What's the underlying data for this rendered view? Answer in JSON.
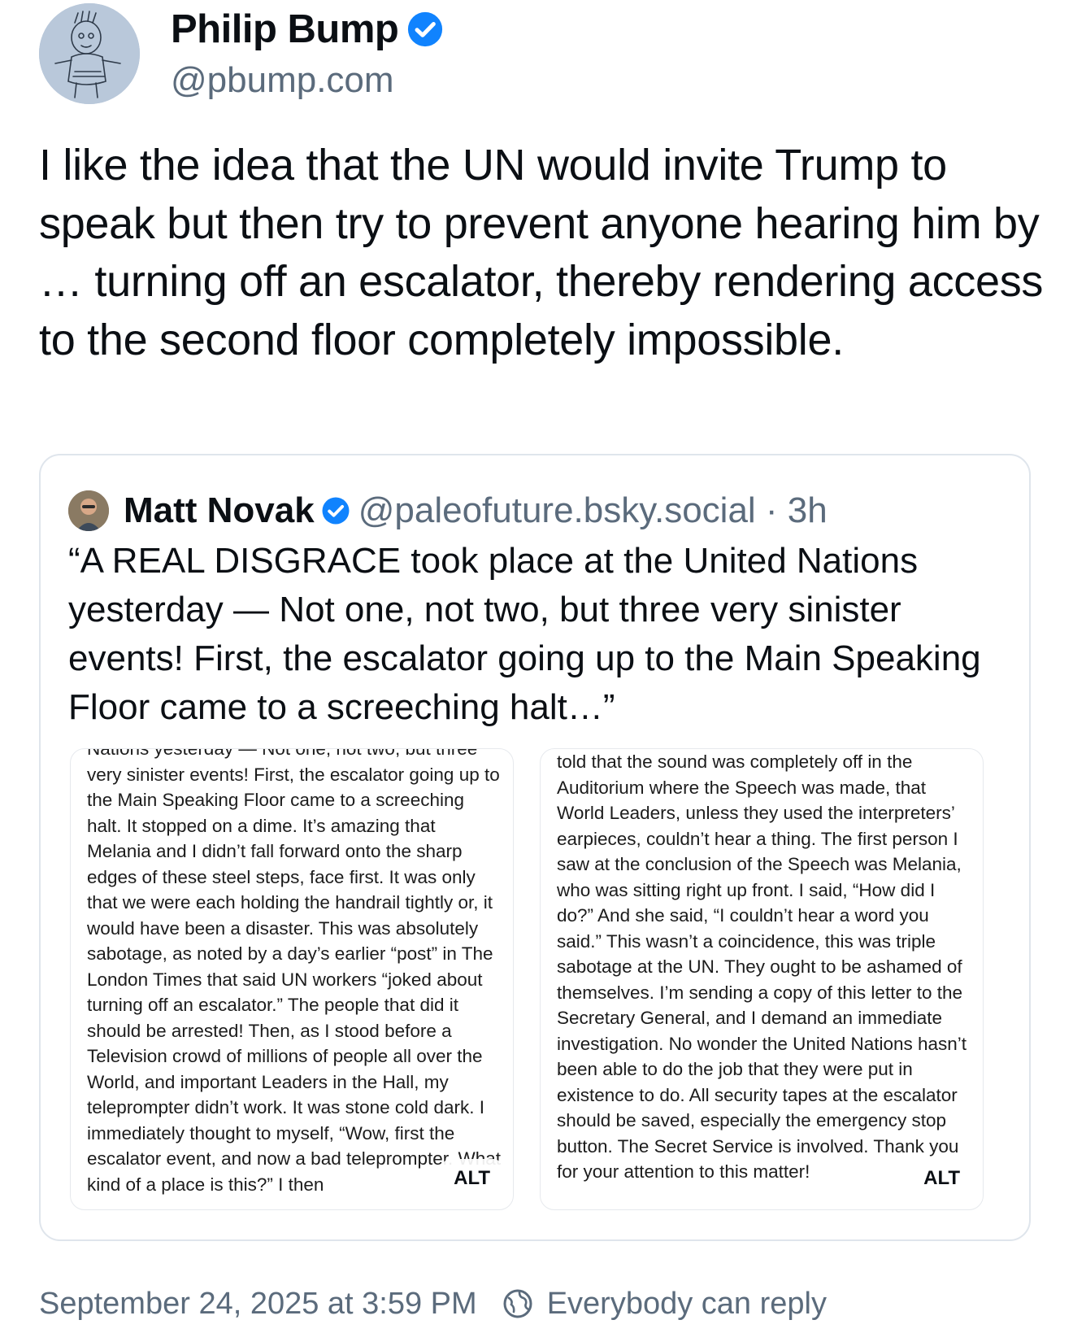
{
  "author": {
    "display_name": "Philip Bump",
    "handle": "@pbump.com",
    "verified_icon": "verified-checkmark-icon",
    "avatar_icon": "sketch-avatar"
  },
  "post": {
    "text": "I like the idea that the UN would invite Trump to speak but then try to prevent anyone hearing him by … turning off an escalator, thereby rendering access to the second floor completely impossible."
  },
  "quote": {
    "display_name": "Matt Novak",
    "handle": "@paleofuture.bsky.social · 3h",
    "verified_icon": "verified-checkmark-icon",
    "text": "“A REAL DISGRACE took place at the United Nations yesterday — Not one, not two, but three very sinister events! First, the escalator going up to the Main Speaking Floor came to a screeching halt…”",
    "images": [
      {
        "text": "Nations yesterday — Not one, not two, but three very sinister events! First, the escalator going up to the Main Speaking Floor came to a screeching halt. It stopped on a dime. It’s amazing that Melania and I didn’t fall forward onto the sharp edges of these steel steps, face first. It was only that we were each holding the handrail tightly or, it would have been a disaster. This was absolutely sabotage, as noted by a day’s earlier “post” in The London Times that said UN workers “joked about turning off an escalator.” The people that did it should be arrested! Then, as I stood before a Television crowd of millions of people all over the World, and important Leaders in the Hall, my teleprompter didn’t work. It was stone cold dark. I immediately thought to myself, “Wow, first the escalator event, and now a bad teleprompter. What kind of a place is this?” I then",
        "alt_label": "ALT"
      },
      {
        "text": "told that the sound was completely off in the Auditorium where the Speech was made, that World Leaders, unless they used the interpreters’ earpieces, couldn’t hear a thing. The first person I saw at the conclusion of the Speech was Melania, who was sitting right up front. I said, “How did I do?” And she said, “I couldn’t hear a word you said.” This wasn’t a coincidence, this was triple sabotage at the UN. They ought to be ashamed of themselves. I’m sending a copy of this letter to the Secretary General, and I demand an immediate investigation. No wonder the United Nations hasn’t been able to do the job that they were put in existence to do. All security tapes at the escalator should be saved, especially the emergency stop button. The Secret Service is involved. Thank you for your attention to this matter!",
        "alt_label": "ALT"
      }
    ]
  },
  "footer": {
    "timestamp": "September 24, 2025 at 3:59 PM",
    "reply_setting": "Everybody can reply",
    "reply_icon": "globe-reply-icon"
  },
  "colors": {
    "accent": "#1083fe",
    "text": "#0b0f14",
    "muted": "#5b6b7c",
    "border": "#dfe5ec"
  }
}
